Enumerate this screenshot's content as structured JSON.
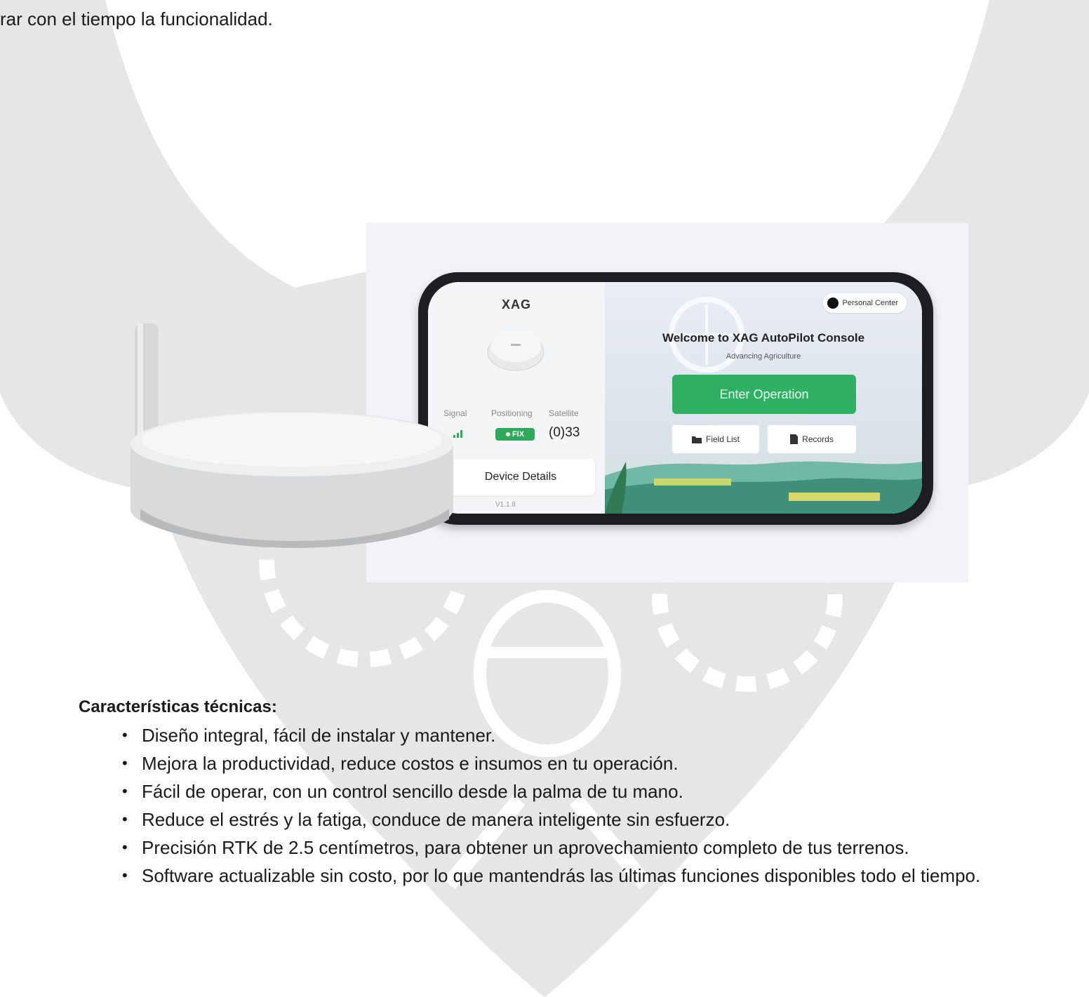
{
  "intro": {
    "text": "rar con el tiempo la funcionalidad."
  },
  "app_screen": {
    "brand": "XAG",
    "stats": {
      "signal_label": "Signal",
      "positioning_label": "Positioning",
      "satellite_label": "Satellite",
      "fix_status": "FIX",
      "satellite_count": "(0)33"
    },
    "device_details_label": "Device Details",
    "version": "V1.1.8",
    "personal_center_label": "Personal Center",
    "welcome_title": "Welcome to XAG AutoPilot Console",
    "tagline": "Advancing Agriculture",
    "enter_button_label": "Enter Operation",
    "field_list_label": "Field List",
    "records_label": "Records"
  },
  "features": {
    "title": "Características técnicas:",
    "items": [
      "Diseño integral, fácil de instalar y mantener.",
      "Mejora la productividad, reduce costos e insumos en tu operación.",
      "Fácil de operar, con un control sencillo desde la palma de tu mano.",
      "Reduce el estrés y la fatiga, conduce de manera inteligente sin esfuerzo.",
      "Precisión RTK de 2.5 centímetros, para obtener un aprovechamiento completo de tus terrenos.",
      "Software actualizable sin costo, por lo que mantendrás las últimas funciones disponibles todo el tiempo."
    ]
  },
  "colors": {
    "watermark": "#e4e4e4",
    "accent_green": "#2fb063",
    "fix_badge": "#2eaa5a",
    "phone_frame": "#1c1e22"
  }
}
